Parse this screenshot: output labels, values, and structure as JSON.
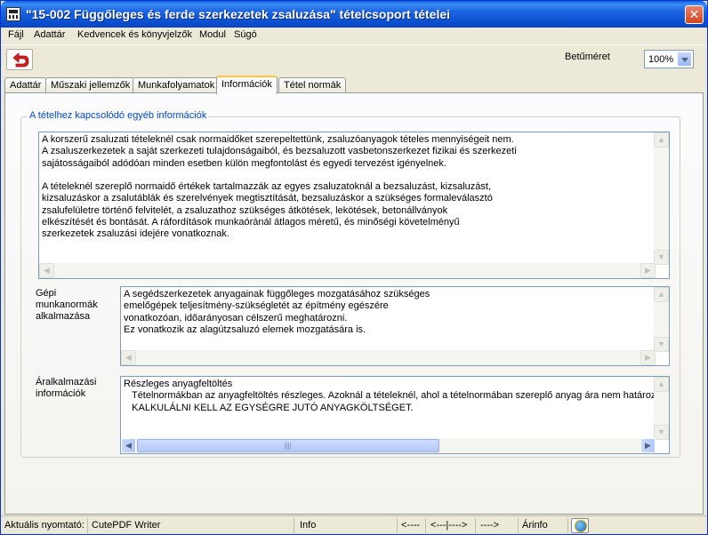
{
  "window": {
    "title": "\"15-002 Függőleges és ferde szerkezetek zsaluzása\" tételcsoport tételei",
    "close_glyph": "✕"
  },
  "menu": [
    "Fájl",
    "Adattár",
    "Kedvencek és könyvjelzők",
    "Modul",
    "Súgó"
  ],
  "toolbar": {
    "font_size_label": "Betűméret",
    "font_size_value": "100%"
  },
  "tabs": [
    "Adattár",
    "Műszaki jellemzők",
    "Munkafolyamatok",
    "Információk",
    "Tétel normák"
  ],
  "active_tab": "Információk",
  "group_title": "A tételhez kapcsolódó egyéb információk",
  "info_text": "A korszerű zsaluzati tételeknél csak normaidőket szerepeltettünk, zsaluzóanyagok tételes mennyiségeit nem.\nA zsaluszerkezetek a saját szerkezeti tulajdonságaiból, és bezsaluzott vasbetonszerkezet fizikai és szerkezeti\nsajátosságaiból adódóan minden esetben külön megfontolást és egyedi tervezést igényelnek.\n\nA tételeknél szereplő normaidő értékek tartalmazzák az egyes zsaluzatoknál a bezsaluzást, kizsaluzást,\nkizsaluzáskor a zsalutáblák és szerelvények megtisztítását, bezsaluzáskor a szükséges formaleválasztó\nzsalufelületre történő felvitelét, a zsaluzathoz szükséges átkötések, lekötések, betonállványok\nelkészítését és bontását. A ráfordítások munkaóránál átlagos méretű, és minőségi követelményű\nszerkezetek zsaluzási idejére vonatkoznak.",
  "machine": {
    "label": "Gépi\nmunkanormák\nalkalmazása",
    "text": "A segédszerkezetek anyagainak függőleges mozgatásához szükséges\nemelőgépek teljesítmény-szükségletét az építmény egészére\nvonatkozóan, időarányosan célszerű meghatározni.\nEz vonatkozik az alagútzsaluzó elemek mozgatására is."
  },
  "pricing": {
    "label": "Áralkalmazási\ninformációk",
    "text": "Részleges anyagfeltöltés\n   Tételnormákban az anyagfeltöltés részleges. Azoknál a tételeknél, ahol a tételnormában szereplő anyag ára nem határozható meg,\n   KALKULÁLNI KELL AZ EGYSÉGRE JUTÓ ANYAGKÖLTSÉGET."
  },
  "statusbar": {
    "printer_label": "Aktuális nyomtató:",
    "printer_value": "CutePDF Writer",
    "info": "Info",
    "nav_left": "<----",
    "nav_mid": "<---|---->",
    "nav_right": "---->",
    "price_info": "Árinfo"
  },
  "colors": {
    "titlebar": "#0a4fd0",
    "window_bg": "#ece9d8",
    "group_title": "#0046d5",
    "back_arrow": "#d8201c"
  },
  "icons": [
    "app-icon",
    "close-icon",
    "back-arrow-icon",
    "chevron-down-icon",
    "globe-icon"
  ]
}
